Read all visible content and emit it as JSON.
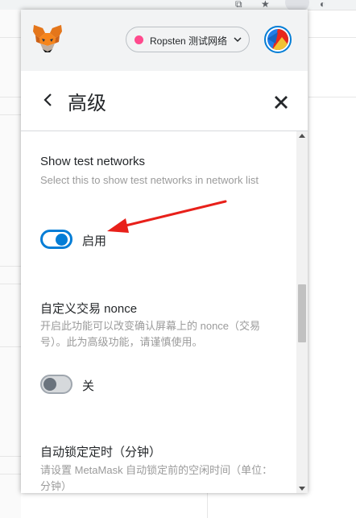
{
  "header": {
    "network_label": "Ropsten 测试网络",
    "network_color": "#ff4a8d",
    "accent_color": "#037dd6"
  },
  "settings": {
    "title": "高级",
    "sections": [
      {
        "title": "Show test networks",
        "description": "Select this to show test networks in network list",
        "toggle_state": "on",
        "toggle_label": "启用"
      },
      {
        "title": "自定义交易 nonce",
        "description": "开启此功能可以改变确认屏幕上的 nonce（交易号）。此为高级功能，请谨慎使用。",
        "toggle_state": "off",
        "toggle_label": "关"
      },
      {
        "title": "自动锁定定时（分钟）",
        "description": "请设置 MetaMask 自动锁定前的空闲时间（单位：分钟）"
      }
    ]
  },
  "annotation": {
    "color": "#e8201a",
    "icon": "red-arrow"
  },
  "icons": [
    "fox-logo-icon",
    "chevron-down-icon",
    "back-arrow-icon",
    "close-icon",
    "red-arrow-icon"
  ]
}
